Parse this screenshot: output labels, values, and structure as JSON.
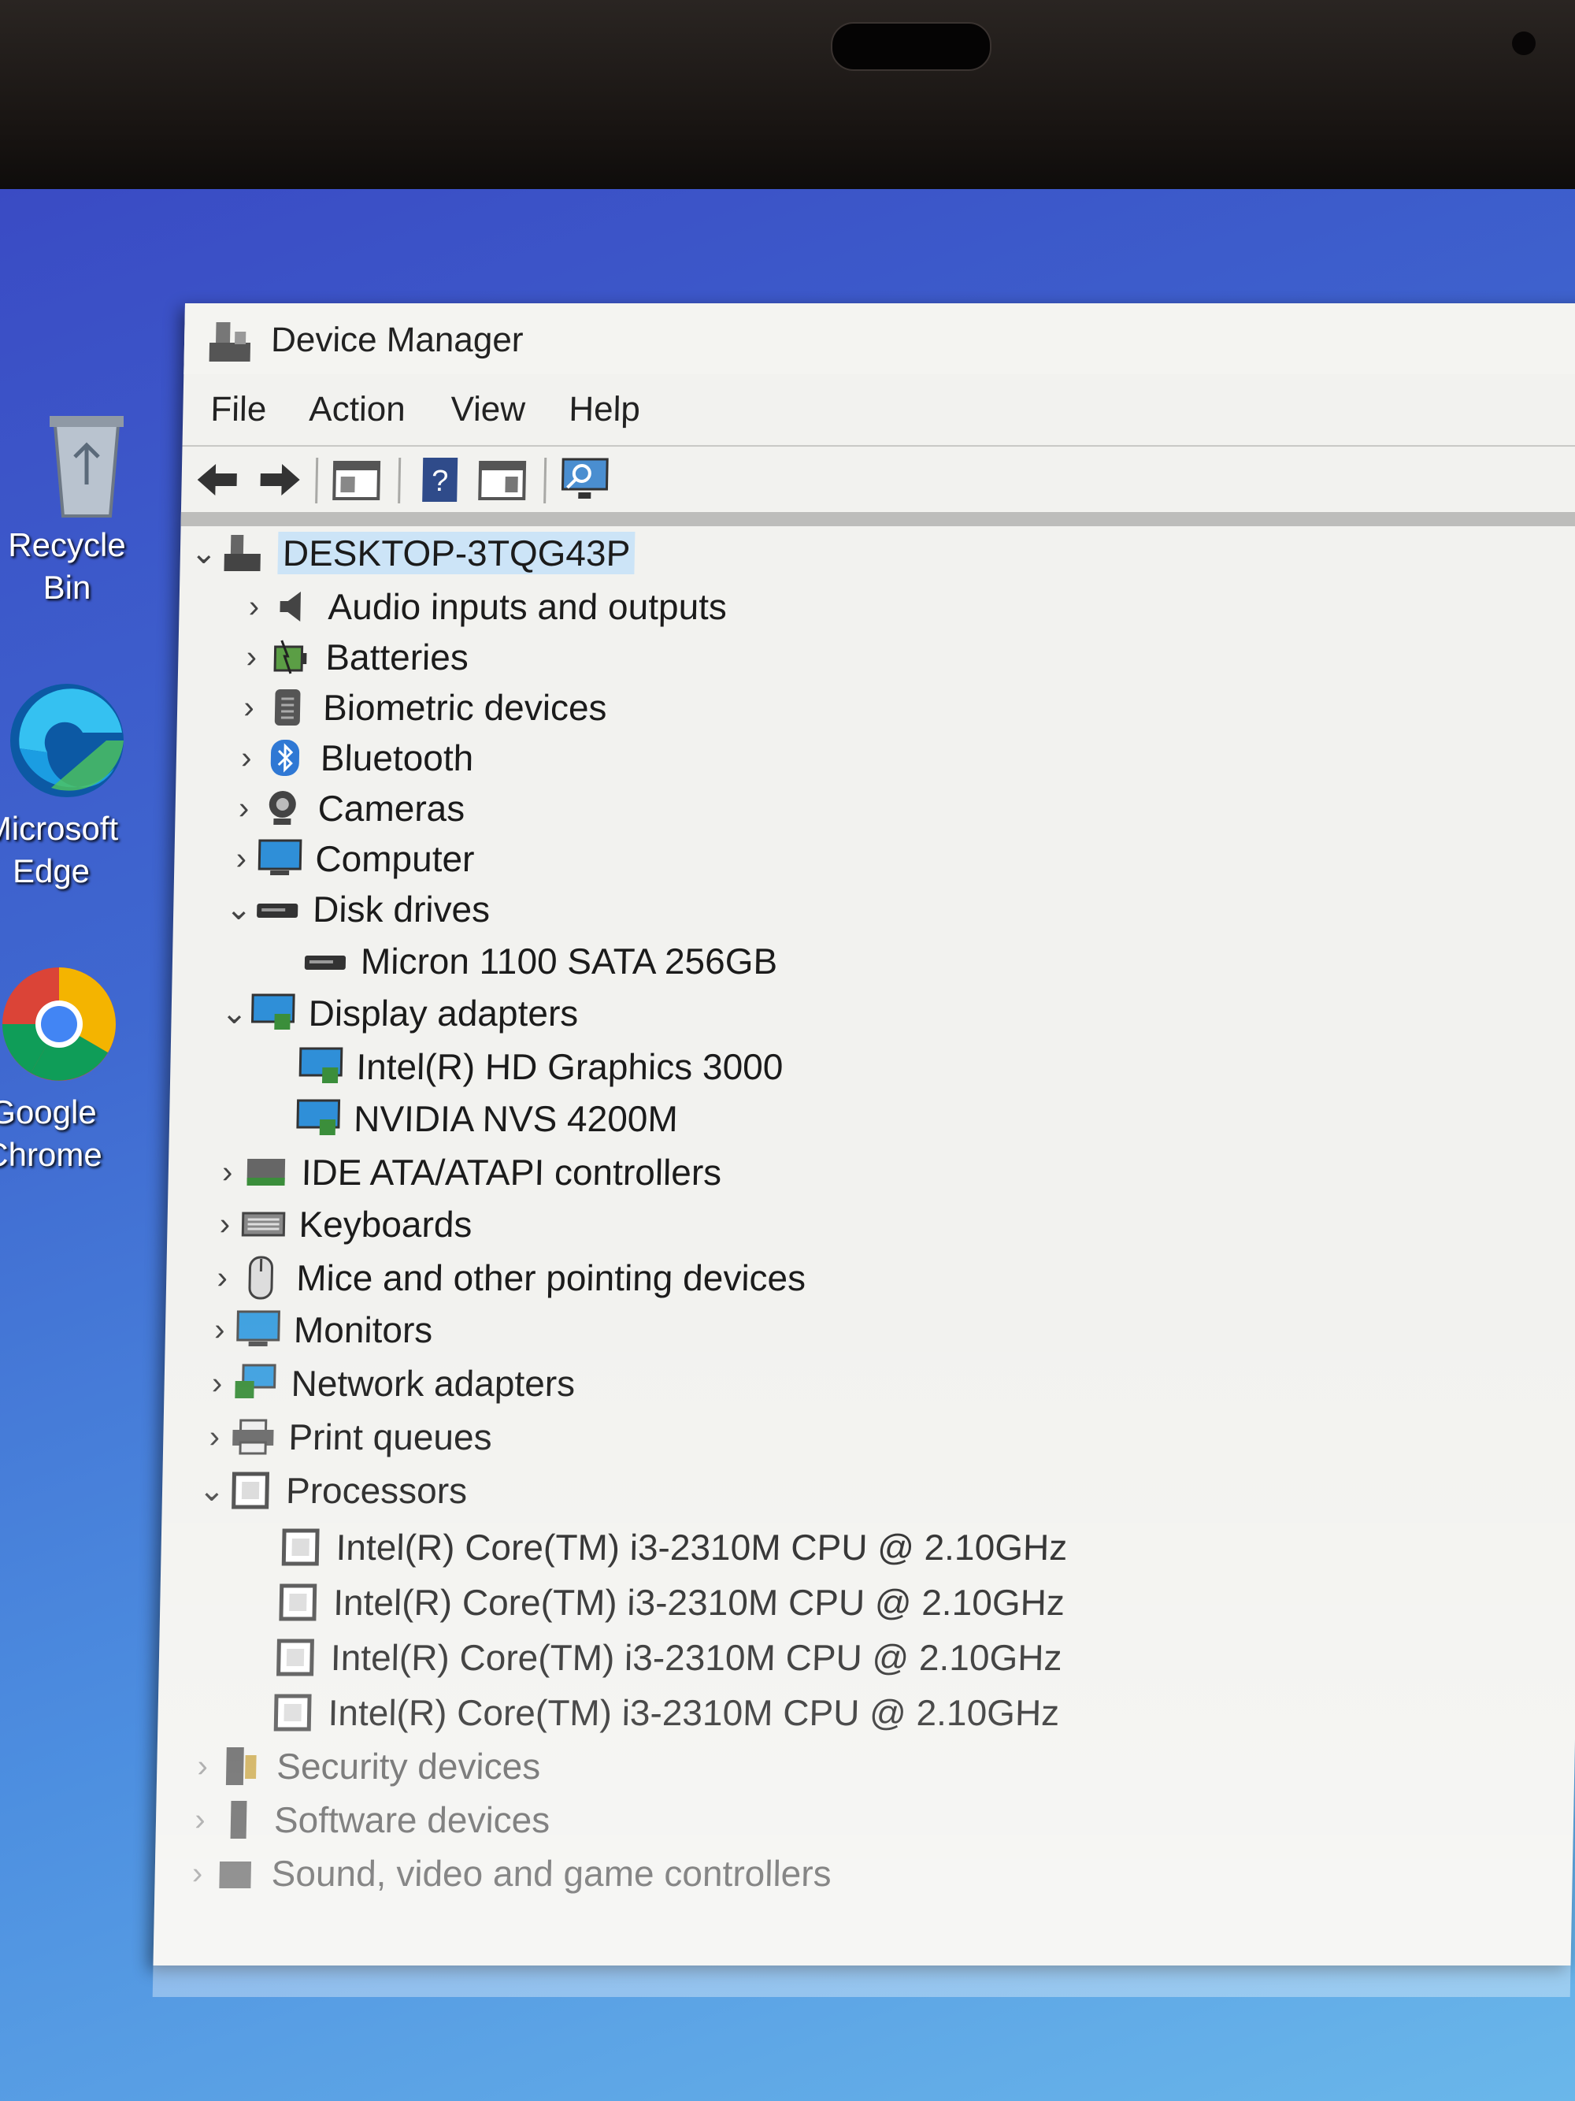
{
  "desktop": {
    "icons": [
      {
        "label_lines": [
          "Recycle Bin"
        ],
        "icon": "recycle-bin-icon"
      },
      {
        "label_lines": [
          "Microsoft",
          "Edge"
        ],
        "icon": "edge-icon"
      },
      {
        "label_lines": [
          "Google",
          "Chrome"
        ],
        "icon": "chrome-icon"
      }
    ]
  },
  "window": {
    "title": "Device Manager",
    "menu": [
      "File",
      "Action",
      "View",
      "Help"
    ],
    "toolbar": [
      "back-arrow-icon",
      "forward-arrow-icon",
      "properties-icon",
      "help-icon",
      "show-hide-console-tree-icon",
      "scan-hardware-icon"
    ]
  },
  "tree": {
    "root": "DESKTOP-3TQG43P",
    "items": [
      {
        "label": "Audio inputs and outputs",
        "expanded": false,
        "icon": "speaker-icon"
      },
      {
        "label": "Batteries",
        "expanded": false,
        "icon": "battery-icon"
      },
      {
        "label": "Biometric devices",
        "expanded": false,
        "icon": "fingerprint-icon"
      },
      {
        "label": "Bluetooth",
        "expanded": false,
        "icon": "bluetooth-icon"
      },
      {
        "label": "Cameras",
        "expanded": false,
        "icon": "camera-icon"
      },
      {
        "label": "Computer",
        "expanded": false,
        "icon": "monitor-icon"
      },
      {
        "label": "Disk drives",
        "expanded": true,
        "icon": "disk-icon",
        "children": [
          "Micron 1100 SATA 256GB"
        ]
      },
      {
        "label": "Display adapters",
        "expanded": true,
        "icon": "display-adapter-icon",
        "children": [
          "Intel(R) HD Graphics 3000",
          "NVIDIA NVS 4200M"
        ]
      },
      {
        "label": "IDE ATA/ATAPI controllers",
        "expanded": false,
        "icon": "ide-controller-icon"
      },
      {
        "label": "Keyboards",
        "expanded": false,
        "icon": "keyboard-icon"
      },
      {
        "label": "Mice and other pointing devices",
        "expanded": false,
        "icon": "mouse-icon"
      },
      {
        "label": "Monitors",
        "expanded": false,
        "icon": "monitor-icon"
      },
      {
        "label": "Network adapters",
        "expanded": false,
        "icon": "network-icon"
      },
      {
        "label": "Print queues",
        "expanded": false,
        "icon": "printer-icon"
      },
      {
        "label": "Processors",
        "expanded": true,
        "icon": "processor-icon",
        "children": [
          "Intel(R) Core(TM) i3-2310M CPU @ 2.10GHz",
          "Intel(R) Core(TM) i3-2310M CPU @ 2.10GHz",
          "Intel(R) Core(TM) i3-2310M CPU @ 2.10GHz",
          "Intel(R) Core(TM) i3-2310M CPU @ 2.10GHz"
        ]
      },
      {
        "label": "Security devices",
        "expanded": false,
        "icon": "security-icon"
      },
      {
        "label": "Software devices",
        "expanded": false,
        "icon": "software-device-icon"
      },
      {
        "label": "Sound, video and game controllers",
        "expanded": false,
        "icon": "sound-controller-icon"
      }
    ]
  }
}
